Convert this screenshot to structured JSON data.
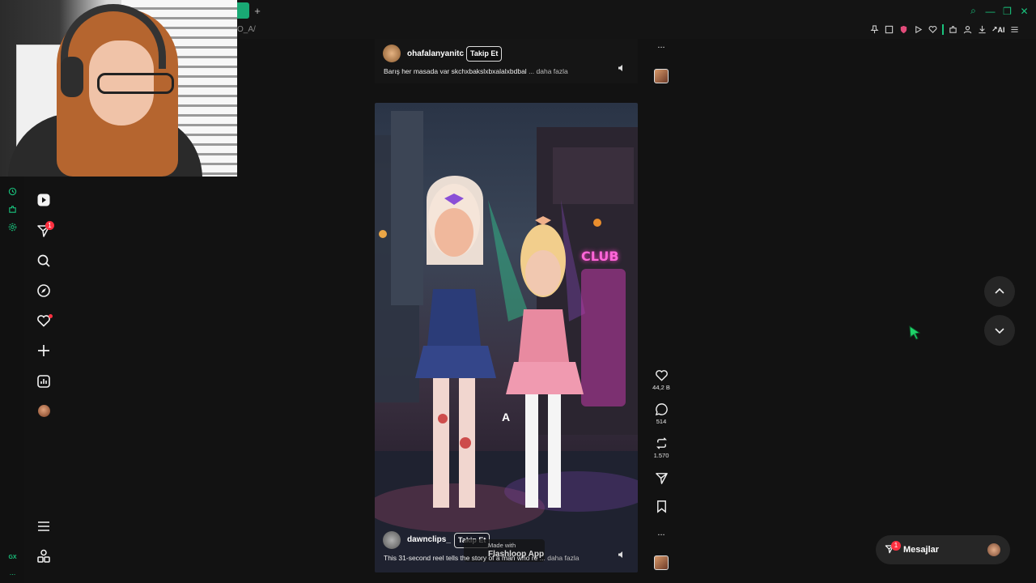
{
  "browser": {
    "url_fragment": "O_A/",
    "new_tab_glyph": "+",
    "ai_label": "AI",
    "window_controls": [
      "⌕",
      "—",
      "❐",
      "✕"
    ]
  },
  "browser_sidebar": {
    "bottom_label": "GX",
    "more": "..."
  },
  "nav": {
    "notification_count": "1"
  },
  "posts": [
    {
      "username": "ohafalanyanitc",
      "follow_label": "Takip Et",
      "caption": "Barış her masada var skchxbakslxbxalalxbdbal",
      "more_label": "... daha fazla"
    },
    {
      "username": "dawnclips_",
      "follow_label": "Takip Et",
      "caption": "This 31-second reel tells the story of a man who re",
      "more_label": "... daha fazla",
      "watermark_line1": "Made with",
      "watermark_line2": "Flashloop App",
      "overlay_letter": "A",
      "sign_text": "CLUB"
    }
  ],
  "actions": {
    "likes": "44,2 B",
    "comments": "514",
    "reposts": "1.570",
    "more": "..."
  },
  "messages": {
    "label": "Mesajlar",
    "badge": "1"
  },
  "colors": {
    "accent": "#19c37d",
    "badge": "#ff3040",
    "background": "#121212"
  }
}
